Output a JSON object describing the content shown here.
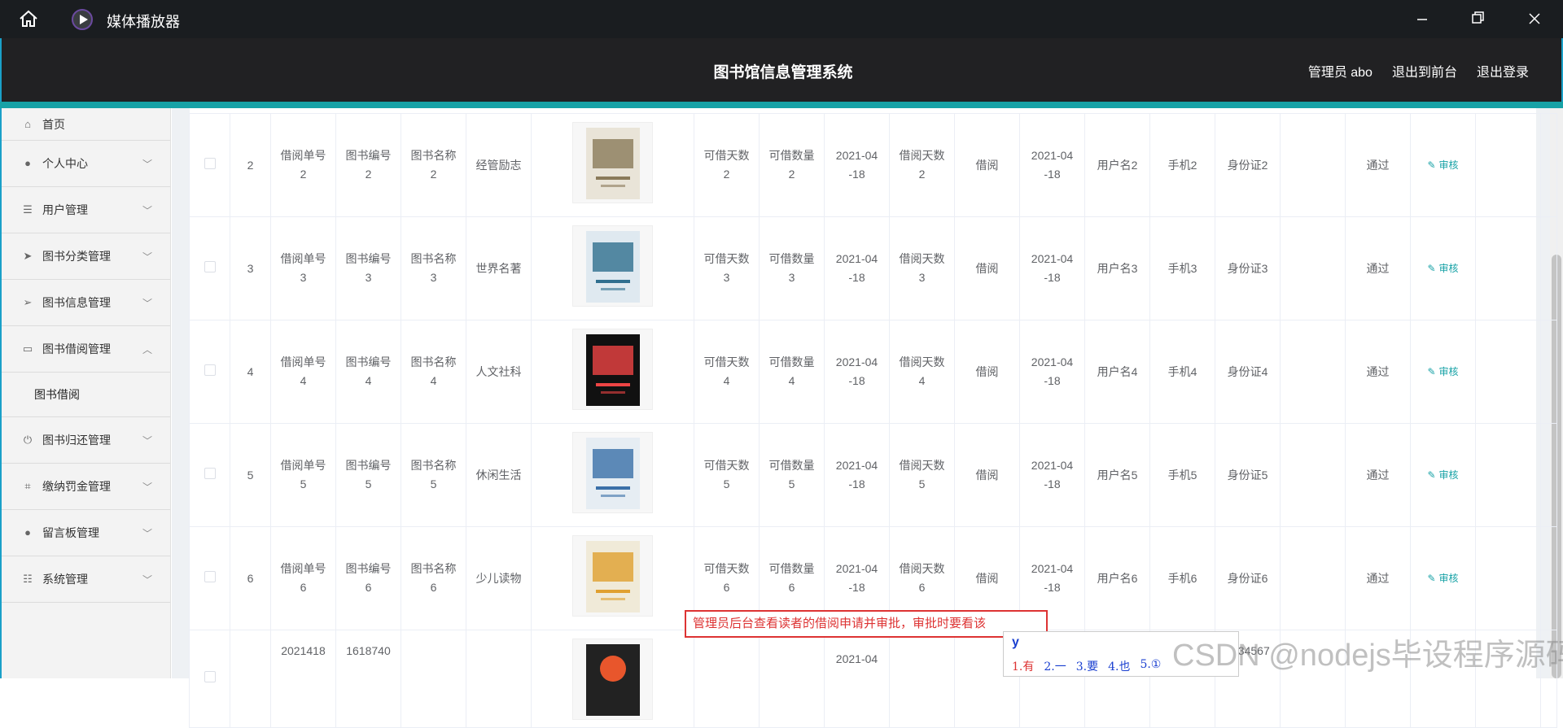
{
  "player": {
    "title": "媒体播放器"
  },
  "header": {
    "system_name": "图书馆信息管理系统",
    "admin_label": "管理员 abo",
    "front_link": "退出到前台",
    "logout_link": "退出登录"
  },
  "sidebar": {
    "items": [
      {
        "label": "首页",
        "icon": "home-icon"
      },
      {
        "label": "个人中心",
        "icon": "user-icon"
      },
      {
        "label": "用户管理",
        "icon": "list-icon"
      },
      {
        "label": "图书分类管理",
        "icon": "send-icon"
      },
      {
        "label": "图书信息管理",
        "icon": "paper-plane-icon"
      },
      {
        "label": "图书借阅管理",
        "icon": "chat-icon"
      },
      {
        "label": "图书归还管理",
        "icon": "power-icon"
      },
      {
        "label": "缴纳罚金管理",
        "icon": "crop-icon"
      },
      {
        "label": "留言板管理",
        "icon": "pin-icon"
      },
      {
        "label": "系统管理",
        "icon": "sliders-icon"
      }
    ],
    "sub_item": "图书借阅"
  },
  "table": {
    "rows": [
      {
        "idx": "2",
        "borrow_no": [
          "借阅单号",
          "2"
        ],
        "book_no": [
          "图书编号",
          "2"
        ],
        "book_name": [
          "图书名称",
          "2"
        ],
        "category": "经管励志",
        "days": [
          "可借天数",
          "2"
        ],
        "qty": [
          "可借数量",
          "2"
        ],
        "date": [
          "2021-04",
          "-18"
        ],
        "borrow_days": [
          "借阅天数",
          "2"
        ],
        "status": "借阅",
        "date2": [
          "2021-04",
          "-18"
        ],
        "user": "用户名2",
        "phone": "手机2",
        "idcard": "身份证2",
        "review": "通过",
        "action": "审核"
      },
      {
        "idx": "3",
        "borrow_no": [
          "借阅单号",
          "3"
        ],
        "book_no": [
          "图书编号",
          "3"
        ],
        "book_name": [
          "图书名称",
          "3"
        ],
        "category": "世界名著",
        "days": [
          "可借天数",
          "3"
        ],
        "qty": [
          "可借数量",
          "3"
        ],
        "date": [
          "2021-04",
          "-18"
        ],
        "borrow_days": [
          "借阅天数",
          "3"
        ],
        "status": "借阅",
        "date2": [
          "2021-04",
          "-18"
        ],
        "user": "用户名3",
        "phone": "手机3",
        "idcard": "身份证3",
        "review": "通过",
        "action": "审核"
      },
      {
        "idx": "4",
        "borrow_no": [
          "借阅单号",
          "4"
        ],
        "book_no": [
          "图书编号",
          "4"
        ],
        "book_name": [
          "图书名称",
          "4"
        ],
        "category": "人文社科",
        "days": [
          "可借天数",
          "4"
        ],
        "qty": [
          "可借数量",
          "4"
        ],
        "date": [
          "2021-04",
          "-18"
        ],
        "borrow_days": [
          "借阅天数",
          "4"
        ],
        "status": "借阅",
        "date2": [
          "2021-04",
          "-18"
        ],
        "user": "用户名4",
        "phone": "手机4",
        "idcard": "身份证4",
        "review": "通过",
        "action": "审核"
      },
      {
        "idx": "5",
        "borrow_no": [
          "借阅单号",
          "5"
        ],
        "book_no": [
          "图书编号",
          "5"
        ],
        "book_name": [
          "图书名称",
          "5"
        ],
        "category": "休闲生活",
        "days": [
          "可借天数",
          "5"
        ],
        "qty": [
          "可借数量",
          "5"
        ],
        "date": [
          "2021-04",
          "-18"
        ],
        "borrow_days": [
          "借阅天数",
          "5"
        ],
        "status": "借阅",
        "date2": [
          "2021-04",
          "-18"
        ],
        "user": "用户名5",
        "phone": "手机5",
        "idcard": "身份证5",
        "review": "通过",
        "action": "审核"
      },
      {
        "idx": "6",
        "borrow_no": [
          "借阅单号",
          "6"
        ],
        "book_no": [
          "图书编号",
          "6"
        ],
        "book_name": [
          "图书名称",
          "6"
        ],
        "category": "少儿读物",
        "days": [
          "可借天数",
          "6"
        ],
        "qty": [
          "可借数量",
          "6"
        ],
        "date": [
          "2021-04",
          "-18"
        ],
        "borrow_days": [
          "借阅天数",
          "6"
        ],
        "status": "借阅",
        "date2": [
          "2021-04",
          "-18"
        ],
        "user": "用户名6",
        "phone": "手机6",
        "idcard": "身份证6",
        "review": "通过",
        "action": "审核"
      }
    ],
    "partial_row": {
      "borrow_no": "2021418",
      "book_no": "1618740",
      "date": "2021-04",
      "tail": "1234567"
    }
  },
  "annotation": "管理员后台查看读者的借阅申请并审批，审批时要看该",
  "ime": {
    "typed": "y",
    "candidates": [
      "1.有",
      "2.一",
      "3.要",
      "4.也",
      "5.①"
    ]
  },
  "watermark": "CSDN @nodejs毕设程序源码"
}
